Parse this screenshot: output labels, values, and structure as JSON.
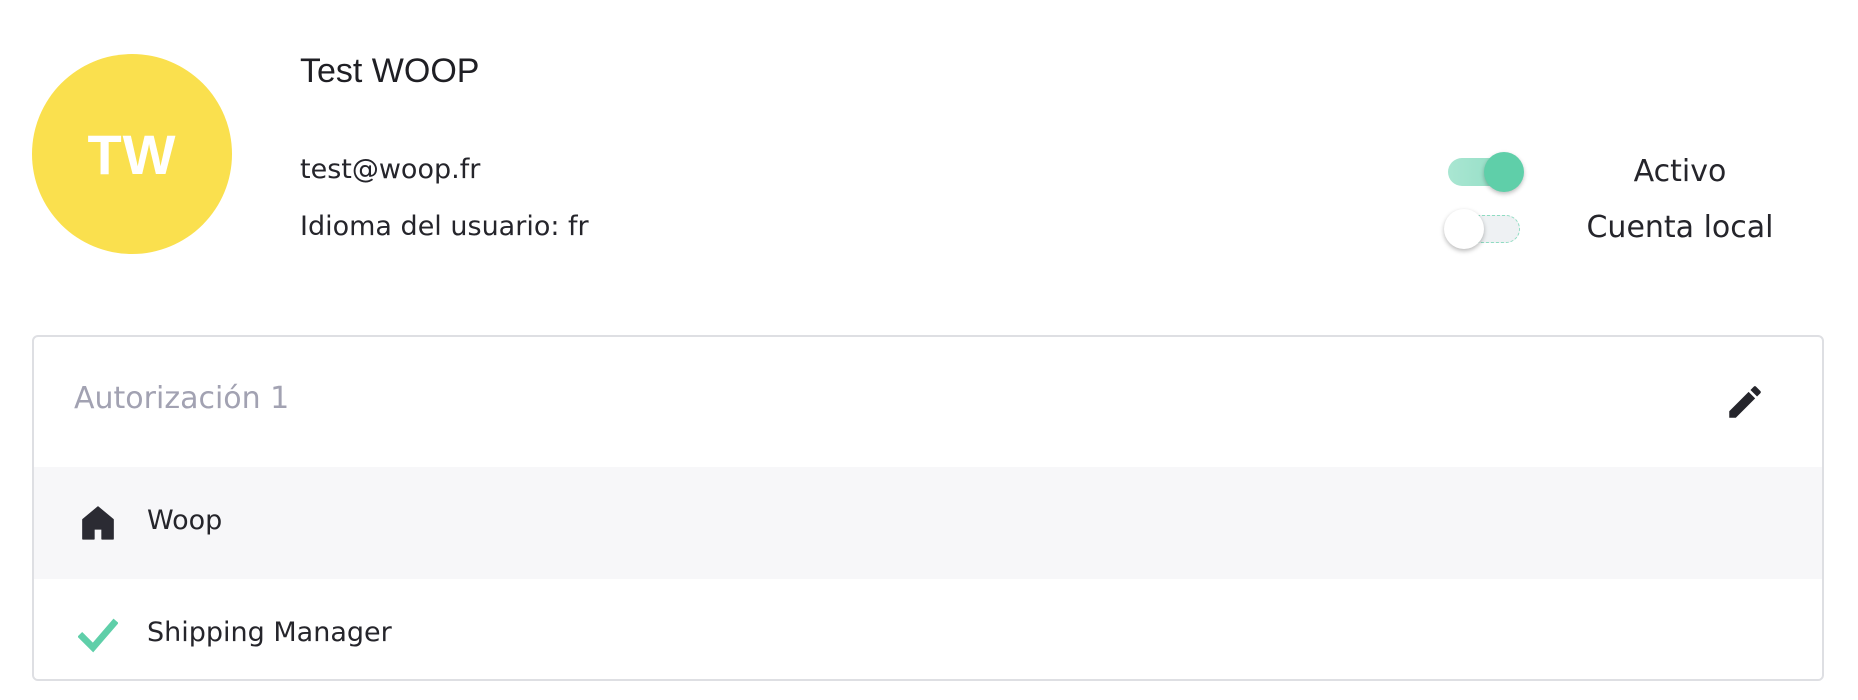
{
  "user": {
    "initials": "TW",
    "avatar_color": "#fae04e",
    "name": "Test WOOP",
    "email": "test@woop.fr",
    "language": "Idioma del usuario: fr"
  },
  "toggles": {
    "active": {
      "label": "Activo",
      "checked": true
    },
    "local_account": {
      "label": "Cuenta local",
      "checked": false
    }
  },
  "authorization": {
    "title": "Autorización 1",
    "edit_icon": "pencil-icon",
    "company": {
      "icon": "home-icon",
      "label": "Woop"
    },
    "role": {
      "icon": "checkmark-icon",
      "label": "Shipping Manager"
    }
  },
  "colors": {
    "accent_green": "#5fcfa9",
    "muted_title": "#a2a2b2",
    "row_highlight": "#f7f7f9"
  }
}
